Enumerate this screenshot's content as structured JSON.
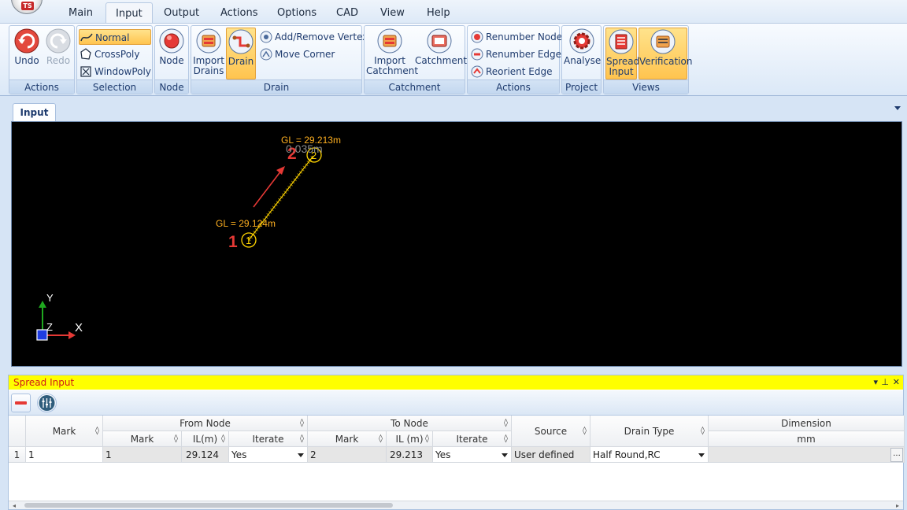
{
  "app": {
    "logo_text": "TS"
  },
  "menu": {
    "tabs": [
      "Main",
      "Input",
      "Output",
      "Actions",
      "Options",
      "CAD",
      "View",
      "Help"
    ],
    "active": "Input"
  },
  "ribbon": {
    "actions": {
      "label": "Actions",
      "undo": "Undo",
      "redo": "Redo"
    },
    "selection": {
      "label": "Selection",
      "normal": "Normal",
      "crosspoly": "CrossPoly",
      "windowpoly": "WindowPoly"
    },
    "node": {
      "label": "Node",
      "node": "Node"
    },
    "drain": {
      "label": "Drain",
      "import_drains_1": "Import",
      "import_drains_2": "Drains",
      "drain": "Drain",
      "add_remove_vertex": "Add/Remove Vertex",
      "move_corner": "Move Corner"
    },
    "catchment": {
      "label": "Catchment",
      "import_catchment_1": "Import",
      "import_catchment_2": "Catchment",
      "catchment": "Catchment"
    },
    "actions2": {
      "label": "Actions",
      "renumber_node": "Renumber Node",
      "renumber_edge": "Renumber Edge",
      "reorient_edge": "Reorient Edge"
    },
    "project": {
      "label": "Project",
      "analyse": "Analyse"
    },
    "views": {
      "label": "Views",
      "spread_input_1": "Spread",
      "spread_input_2": "Input",
      "verification": "Verification"
    }
  },
  "document": {
    "tab": "Input"
  },
  "cad": {
    "node1": {
      "number": "1",
      "label": "1",
      "gl": "GL = 29.124m"
    },
    "node2": {
      "number": "2",
      "label": "2",
      "gl": "GL = 29.213m",
      "overlap_text": "0.035m"
    },
    "axis": {
      "y": "Y",
      "z": "Z",
      "x": "X"
    },
    "colors": {
      "background": "#000000",
      "node": "#ffd400",
      "number": "#e53935",
      "gl_text": "#ffb020",
      "arrow": "#e53935"
    }
  },
  "spread": {
    "title": "Spread Input",
    "title_controls": {
      "dropdown": "▾",
      "pin": "⊥",
      "close": "✕"
    },
    "headers": {
      "mark": "Mark",
      "from_node": "From Node",
      "from_mark": "Mark",
      "from_il": "IL(m)",
      "from_iterate": "Iterate",
      "to_node": "To Node",
      "to_mark": "Mark",
      "to_il": "IL (m)",
      "to_iterate": "Iterate",
      "source": "Source",
      "drain_type": "Drain Type",
      "dimension": "Dimension",
      "dimension_unit": "mm",
      "sort_glyph": "◊"
    },
    "rows": [
      {
        "row_num": "1",
        "mark": "1",
        "from_mark": "1",
        "from_il": "29.124",
        "from_iterate": "Yes",
        "to_mark": "2",
        "to_il": "29.213",
        "to_iterate": "Yes",
        "source": "User defined",
        "drain_type": "Half Round,RC",
        "dimension_btn": "..."
      }
    ]
  }
}
